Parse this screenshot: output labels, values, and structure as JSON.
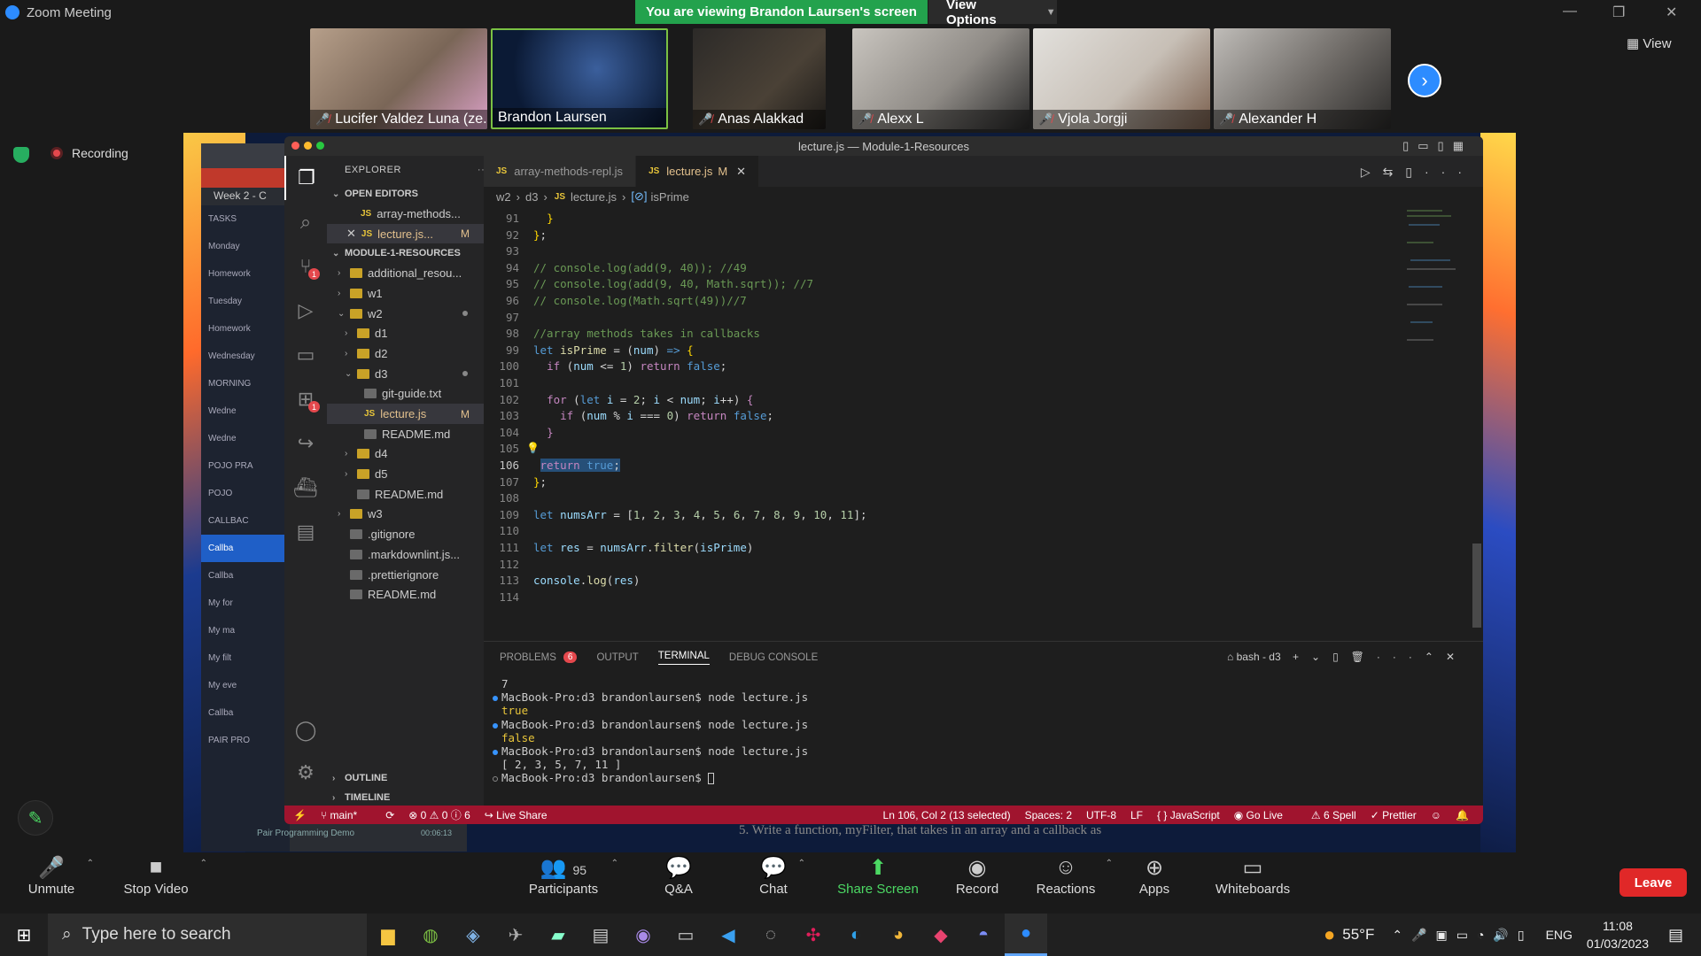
{
  "zoom": {
    "window_title": "Zoom Meeting",
    "share_banner": "You are viewing Brandon Laursen's screen",
    "view_options": "View Options",
    "view_label": "View",
    "recording": "Recording",
    "participants": [
      {
        "name": "Lucifer Valdez Luna (ze...",
        "muted": true
      },
      {
        "name": "Brandon Laursen",
        "muted": false
      },
      {
        "name": "Anas Alakkad",
        "muted": true
      },
      {
        "name": "Alexx L",
        "muted": true
      },
      {
        "name": "Vjola Jorgji",
        "muted": true
      },
      {
        "name": "Alexander H",
        "muted": true
      }
    ],
    "toolbar": {
      "unmute": "Unmute",
      "stop_video": "Stop Video",
      "participants": "Participants",
      "participants_count": "95",
      "qa": "Q&A",
      "chat": "Chat",
      "share_screen": "Share Screen",
      "record": "Record",
      "reactions": "Reactions",
      "apps": "Apps",
      "whiteboards": "Whiteboards",
      "leave": "Leave"
    }
  },
  "browser": {
    "week_label": "Week 2 - C",
    "tasks": "TASKS",
    "items": [
      "Monday",
      "Homework",
      "Tuesday",
      "Homework",
      "Wednesday",
      "MORNING",
      "Wedne",
      "Wedne",
      "POJO PRA",
      "POJO",
      "CALLBAC",
      "Callba",
      "Callba",
      "My for",
      "My ma",
      "My filt",
      "My eve",
      "Callba",
      "PAIR PRO",
      "Pair Programming Demo"
    ],
    "time": "00:06:13"
  },
  "vscode": {
    "title": "lecture.js — Module-1-Resources",
    "explorer": "EXPLORER",
    "open_editors": "OPEN EDITORS",
    "open_files": [
      "array-methods...",
      "lecture.js..."
    ],
    "workspace": "MODULE-1-RESOURCES",
    "tree": [
      {
        "label": "additional_resou...",
        "type": "folder",
        "depth": 1,
        "open": false
      },
      {
        "label": "w1",
        "type": "folder",
        "depth": 1,
        "open": false
      },
      {
        "label": "w2",
        "type": "folder",
        "depth": 1,
        "open": true
      },
      {
        "label": "d1",
        "type": "folder",
        "depth": 2,
        "open": false
      },
      {
        "label": "d2",
        "type": "folder",
        "depth": 2,
        "open": false
      },
      {
        "label": "d3",
        "type": "folder",
        "depth": 2,
        "open": true
      },
      {
        "label": "git-guide.txt",
        "type": "file",
        "depth": 3
      },
      {
        "label": "lecture.js",
        "type": "js",
        "depth": 3
      },
      {
        "label": "README.md",
        "type": "file",
        "depth": 3
      },
      {
        "label": "d4",
        "type": "folder",
        "depth": 2,
        "open": false
      },
      {
        "label": "d5",
        "type": "folder",
        "depth": 2,
        "open": false
      },
      {
        "label": "README.md",
        "type": "file",
        "depth": 2
      },
      {
        "label": "w3",
        "type": "folder",
        "depth": 1,
        "open": false
      },
      {
        "label": ".gitignore",
        "type": "file",
        "depth": 1
      },
      {
        "label": ".markdownlint.js...",
        "type": "file",
        "depth": 1
      },
      {
        "label": ".prettierignore",
        "type": "file",
        "depth": 1
      },
      {
        "label": "README.md",
        "type": "file",
        "depth": 1
      }
    ],
    "outline": "OUTLINE",
    "timeline": "TIMELINE",
    "tabs": [
      "array-methods-repl.js",
      "lecture.js"
    ],
    "tab_modified": "M",
    "breadcrumb": [
      "w2",
      "d3",
      "lecture.js",
      "isPrime"
    ],
    "panel_tabs": [
      "PROBLEMS",
      "OUTPUT",
      "TERMINAL",
      "DEBUG CONSOLE"
    ],
    "problems_count": "6",
    "terminal_name": "bash - d3",
    "terminal_lines": [
      "7",
      "MacBook-Pro:d3 brandonlaursen$ node lecture.js",
      "true",
      "MacBook-Pro:d3 brandonlaursen$ node lecture.js",
      "false",
      "MacBook-Pro:d3 brandonlaursen$ node lecture.js",
      "[ 2, 3, 5, 7, 11 ]",
      "MacBook-Pro:d3 brandonlaursen$ "
    ],
    "status": {
      "branch": "main*",
      "errors": "⊗ 0 ⚠ 0 ⓘ 6",
      "live_share": "Live Share",
      "position": "Ln 106, Col 2 (13 selected)",
      "spaces": "Spaces: 2",
      "encoding": "UTF-8",
      "eol": "LF",
      "language": "{ } JavaScript",
      "go_live": "Go Live",
      "spell": "⚠ 6 Spell",
      "prettier": "✓ Prettier"
    },
    "line_numbers": [
      "91",
      "92",
      "93",
      "94",
      "95",
      "96",
      "97",
      "98",
      "99",
      "100",
      "101",
      "102",
      "103",
      "104",
      "105",
      "106",
      "107",
      "108",
      "109",
      "110",
      "111",
      "112",
      "113",
      "114"
    ]
  },
  "caption_below": "5.   Write a function, myFilter, that takes in an array and a callback as",
  "taskbar": {
    "search": "Type here to search",
    "weather": "55°F",
    "lang": "ENG",
    "time": "11:08",
    "date": "01/03/2023"
  }
}
